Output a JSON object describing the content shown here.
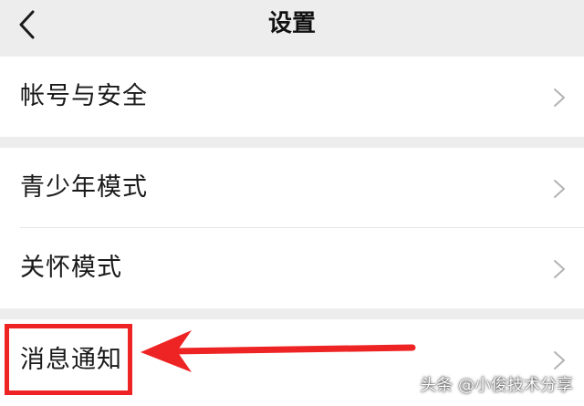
{
  "header": {
    "title": "设置",
    "back_icon": "chevron-left-icon"
  },
  "groups": [
    {
      "items": [
        {
          "label": "帐号与安全",
          "icon": "chevron-right-icon"
        }
      ]
    },
    {
      "items": [
        {
          "label": "青少年模式",
          "icon": "chevron-right-icon"
        },
        {
          "label": "关怀模式",
          "icon": "chevron-right-icon"
        }
      ]
    },
    {
      "items": [
        {
          "label": "消息通知",
          "icon": "chevron-right-icon",
          "highlighted": true
        }
      ]
    }
  ],
  "annotation": {
    "highlight_color": "#ee2323",
    "arrow_color": "#ee2323"
  },
  "watermark": {
    "text": "头条 @小俊技术分享"
  },
  "colors": {
    "background": "#ededed",
    "row_background": "#ffffff",
    "text": "#1a1a1a",
    "chevron": "#b3b3b3"
  }
}
